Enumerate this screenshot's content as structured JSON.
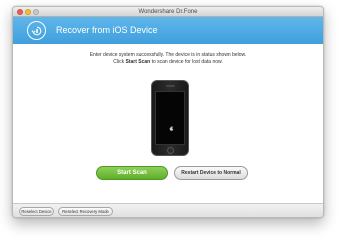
{
  "window": {
    "title": "Wondershare Dr.Fone"
  },
  "header": {
    "title": "Recover from iOS Device",
    "icon": "restore-icon",
    "accent_color": "#4aa8e3"
  },
  "instructions": {
    "line1": "Enter device system successfully. The device is in status shown below.",
    "line2_prefix": "Click ",
    "line2_bold": "Start Scan",
    "line2_suffix": " to scan device for lost data now."
  },
  "actions": {
    "start_scan_label": "Start Scan",
    "start_scan_color": "#6cbb35",
    "restart_label": "Restart Device to Normal"
  },
  "footer": {
    "reselect_device_label": "Reselect Device",
    "reselect_mode_label": "Reselect Recovery Mode"
  }
}
